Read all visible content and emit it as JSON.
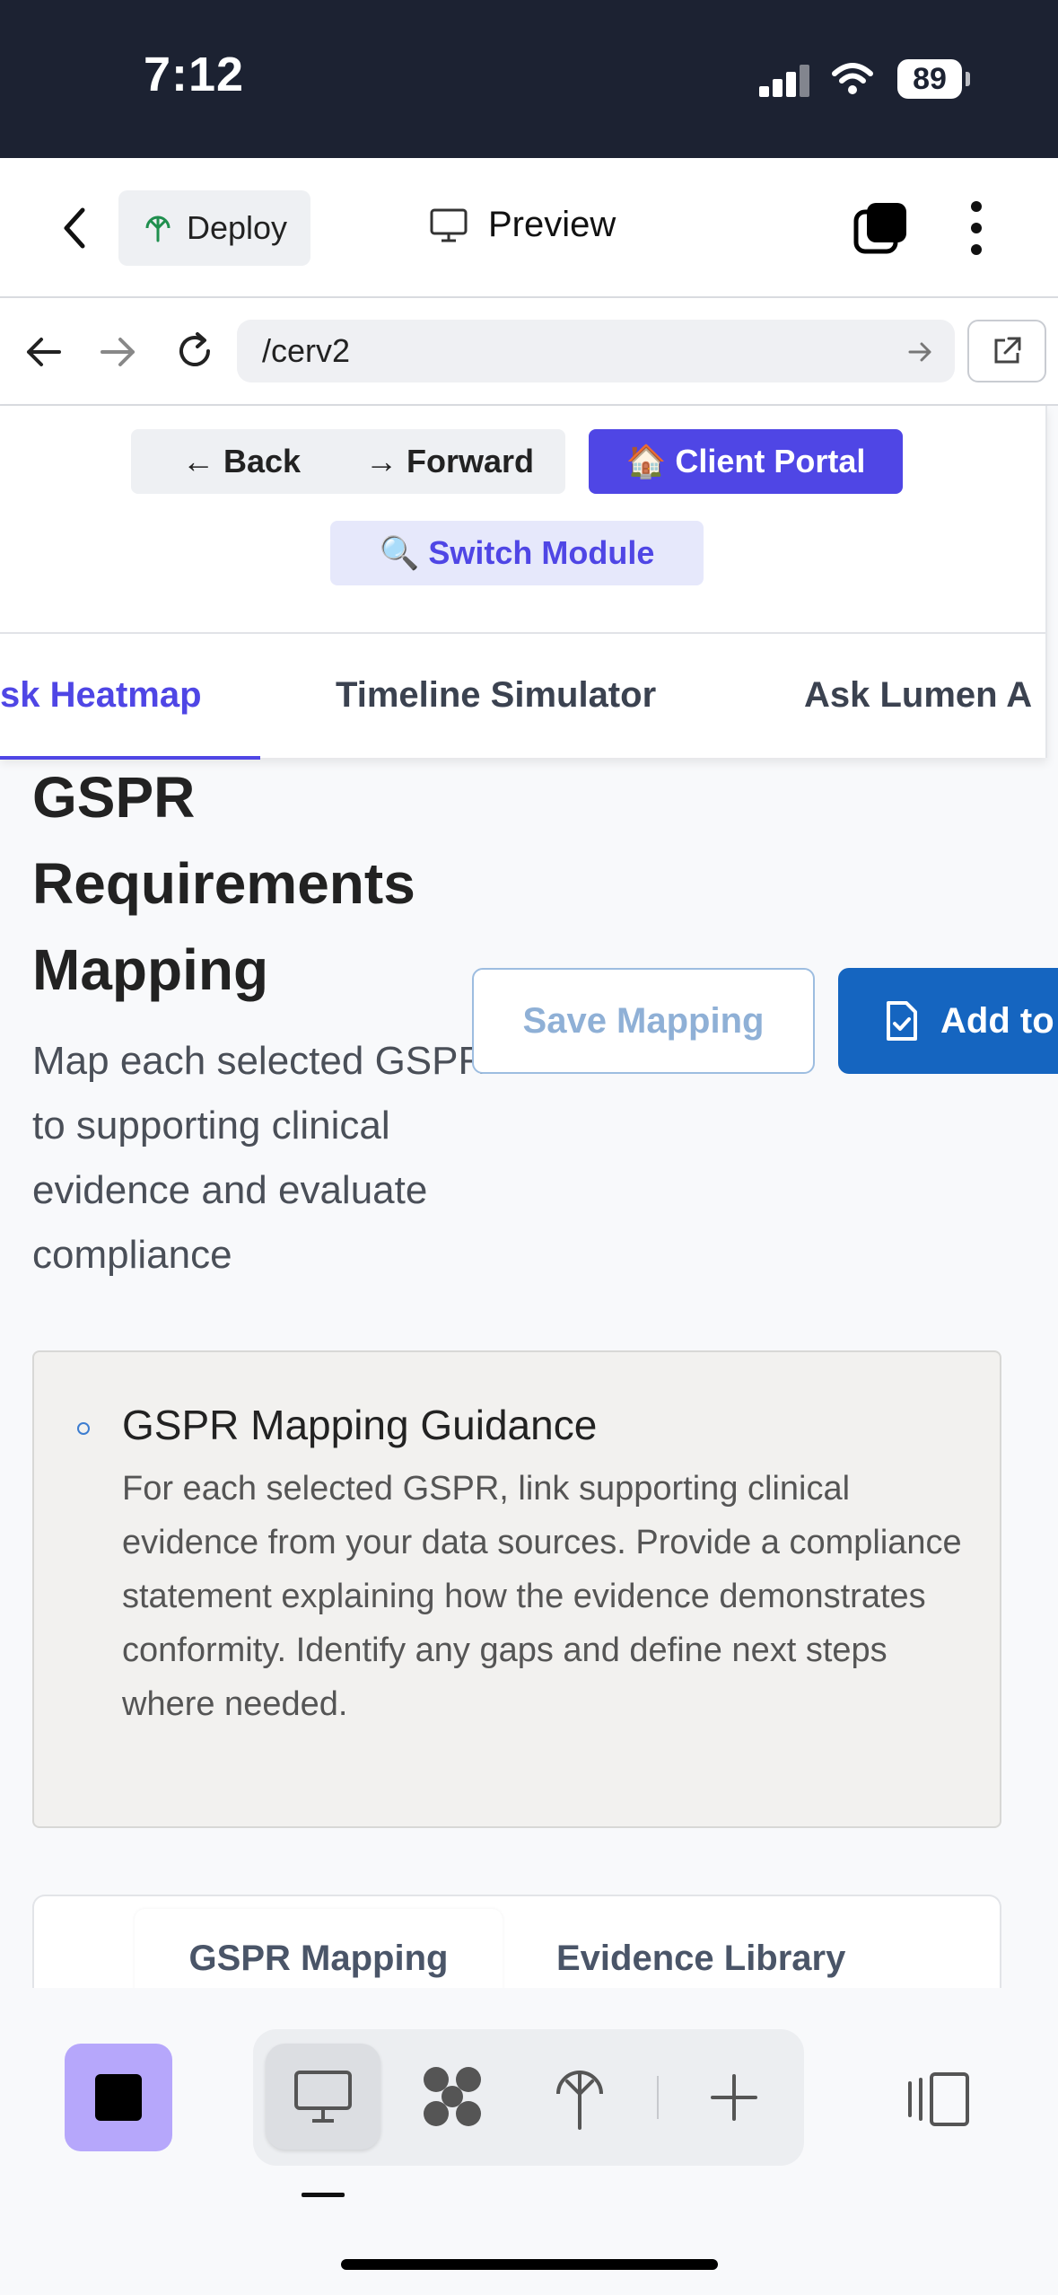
{
  "status_bar": {
    "time": "7:12",
    "battery": "89"
  },
  "editor_toolbar": {
    "deploy_label": "Deploy",
    "preview_label": "Preview"
  },
  "browser": {
    "url": "/cerv2"
  },
  "app_nav": {
    "back_label": "← Back",
    "forward_label": "→ Forward",
    "client_portal_label": "🏠 Client Portal",
    "switch_module_label": "🔍 Switch Module",
    "tabs": [
      {
        "label": "sk Heatmap",
        "active": true
      },
      {
        "label": "Timeline Simulator",
        "active": false
      },
      {
        "label": "Ask Lumen A",
        "active": false
      }
    ]
  },
  "page": {
    "title": "GSPR Requirements Mapping",
    "subtitle": "Map each selected GSPR to supporting clinical evidence and evaluate compliance",
    "save_button": "Save Mapping",
    "add_button": "Add to"
  },
  "guidance": {
    "title": "GSPR Mapping Guidance",
    "body": "For each selected GSPR, link supporting clinical evidence from your data sources. Provide a compliance statement explaining how the evidence demonstrates conformity. Identify any gaps and define next steps where needed."
  },
  "subtabs": [
    "GSPR Mapping",
    "Evidence Library"
  ],
  "colors": {
    "accent": "#4f46e5",
    "primary_blue": "#1565c0",
    "stop_button": "#b6a7fb",
    "status_bar_bg": "#1c2232"
  },
  "icons": [
    "chevron-left-icon",
    "deploy-icon",
    "monitor-icon",
    "layers-icon",
    "more-vertical-icon",
    "arrow-left-icon",
    "arrow-right-icon",
    "reload-icon",
    "external-link-icon",
    "file-check-icon",
    "stop-icon",
    "desktop-icon",
    "puzzle-icon",
    "deploy-tree-icon",
    "plus-icon",
    "panel-toggle-icon"
  ]
}
